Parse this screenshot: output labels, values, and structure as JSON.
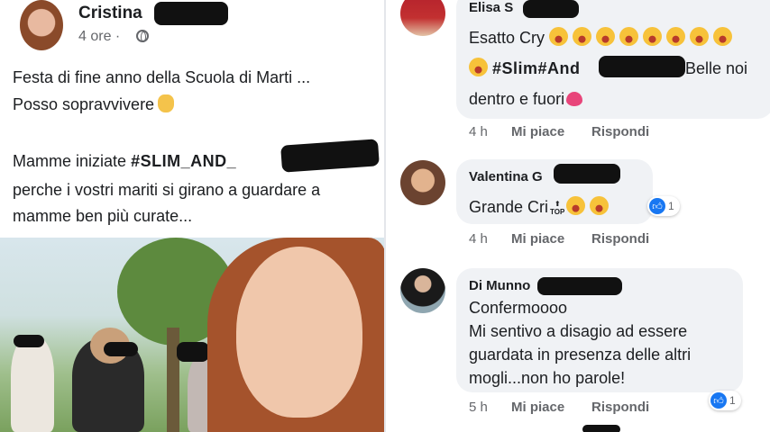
{
  "post": {
    "author": "Cristina",
    "time": "4 ore",
    "separator": "·",
    "line1": "Festa di fine anno della Scuola di Marti ...",
    "line2": "Posso sopravvivere",
    "line3_prefix": "Mamme iniziate",
    "line3_hashtag": "#SLIM_AND_",
    "line4": "perche i vostri mariti si girano a guardare a",
    "line5": "mamme ben più  curate..."
  },
  "comments": [
    {
      "name": "Elisa S",
      "text_line1": "Esatto Cry",
      "text_line2_hashtag1": "#Slim",
      "text_line2_hashtag2": "#And",
      "text_line2_rest": "Belle noi",
      "text_line3": "dentro e fuori",
      "time": "4 h",
      "like": "Mi piace",
      "reply": "Rispondi"
    },
    {
      "name": "Valentina G",
      "text": "Grande Cri",
      "top_label": "TOP",
      "reactions": "1",
      "time": "4 h",
      "like": "Mi piace",
      "reply": "Rispondi"
    },
    {
      "name": "Di Munno",
      "text_line1": "Confermoooo",
      "text_line2": "Mi sentivo a disagio ad essere",
      "text_line3": "guardata in presenza delle altri",
      "text_line4": "mogli...non ho parole!",
      "reactions": "1",
      "time": "5 h",
      "like": "Mi piace",
      "reply": "Rispondi"
    }
  ],
  "colors": {
    "accent": "#1877f2",
    "bubble": "#f0f2f5",
    "meta": "#65676b"
  }
}
